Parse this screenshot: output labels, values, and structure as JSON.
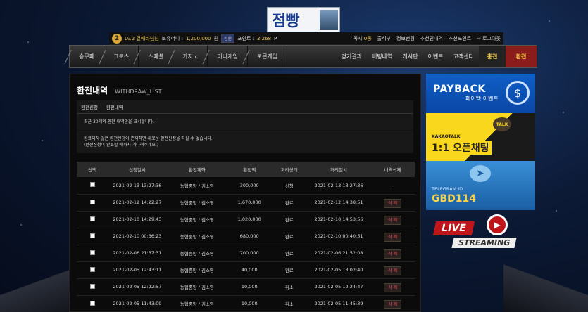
{
  "brand": {
    "logo_text": "점빵"
  },
  "userbar": {
    "level": "2",
    "level_text": "Lv.2 열매라님님",
    "balance_label": "보유머니 :",
    "balance_value": "1,200,000",
    "balance_unit": "원",
    "convert_label": "전환",
    "point_label": "포인트 :",
    "point_value": "3,268",
    "point_unit": "P",
    "links": [
      {
        "label": "쪽지:",
        "value": "0통"
      },
      {
        "label": "출석부"
      },
      {
        "label": "정보변경"
      },
      {
        "label": "추천인내역"
      },
      {
        "label": "추천포인트"
      },
      {
        "label": "⇨ 로그아웃"
      }
    ]
  },
  "nav": {
    "left": [
      "승무패",
      "크로스",
      "스페셜",
      "카지노",
      "미니게임",
      "토큰게임"
    ],
    "right": [
      "경기결과",
      "베팅내역",
      "게시판",
      "이벤트",
      "고객센터"
    ],
    "charge": "충전",
    "withdraw": "환전"
  },
  "page": {
    "title": "환전내역",
    "subtitle": "WITHDRAW_LIST",
    "tabs": [
      "환전신청",
      "환전내역"
    ],
    "notice1": "최근 30개의 환전 내역만을 표시합니다.",
    "notice2a": "환료되지 않은 환전신청이 존재하면 새로운 환전신청을 하실 수 없습니다.",
    "notice2b": "(환전신청이 완료될 때까지 기다려주세요.)"
  },
  "table": {
    "headers": [
      "선택",
      "신청일시",
      "환전계좌",
      "환전액",
      "처리상태",
      "처리일시",
      "내역삭제"
    ],
    "delete_label": "삭 제",
    "rows": [
      {
        "date": "2021-02-13 13:27:36",
        "account": "농협중앙 / 김소영",
        "amount": "300,000",
        "status": "신청",
        "done": "2021-02-13 13:27:36",
        "del": "-"
      },
      {
        "date": "2021-02-12 14:22:27",
        "account": "농협중앙 / 김소영",
        "amount": "1,670,000",
        "status": "완료",
        "done": "2021-02-12 14:38:51",
        "del": "btn"
      },
      {
        "date": "2021-02-10 14:29:43",
        "account": "농협중앙 / 김소영",
        "amount": "1,020,000",
        "status": "완료",
        "done": "2021-02-10 14:53:56",
        "del": "btn"
      },
      {
        "date": "2021-02-10 00:36:23",
        "account": "농협중앙 / 김소영",
        "amount": "680,000",
        "status": "완료",
        "done": "2021-02-10 00:40:51",
        "del": "btn"
      },
      {
        "date": "2021-02-06 21:37:31",
        "account": "농협중앙 / 김소영",
        "amount": "700,000",
        "status": "완료",
        "done": "2021-02-06 21:52:08",
        "del": "btn"
      },
      {
        "date": "2021-02-05 12:43:11",
        "account": "농협중앙 / 김소영",
        "amount": "40,000",
        "status": "완료",
        "done": "2021-02-05 13:02:40",
        "del": "btn"
      },
      {
        "date": "2021-02-05 12:22:57",
        "account": "농협중앙 / 김소영",
        "amount": "10,000",
        "status": "취소",
        "done": "2021-02-05 12:24:47",
        "del": "btn"
      },
      {
        "date": "2021-02-05 11:43:09",
        "account": "농협중앙 / 김소영",
        "amount": "10,000",
        "status": "취소",
        "done": "2021-02-05 11:45:39",
        "del": "btn"
      }
    ]
  },
  "side": {
    "payback_title": "PAYBACK",
    "payback_sub": "페이백 이벤트",
    "kakao_bubble": "TALK",
    "kakao_label": "KAKAOTALK",
    "kakao_title": "1:1 오픈채팅",
    "telegram_label": "TELEGRAM ID",
    "telegram_id": "GBD114",
    "live": "LIVE",
    "streaming": "STREAMING"
  }
}
